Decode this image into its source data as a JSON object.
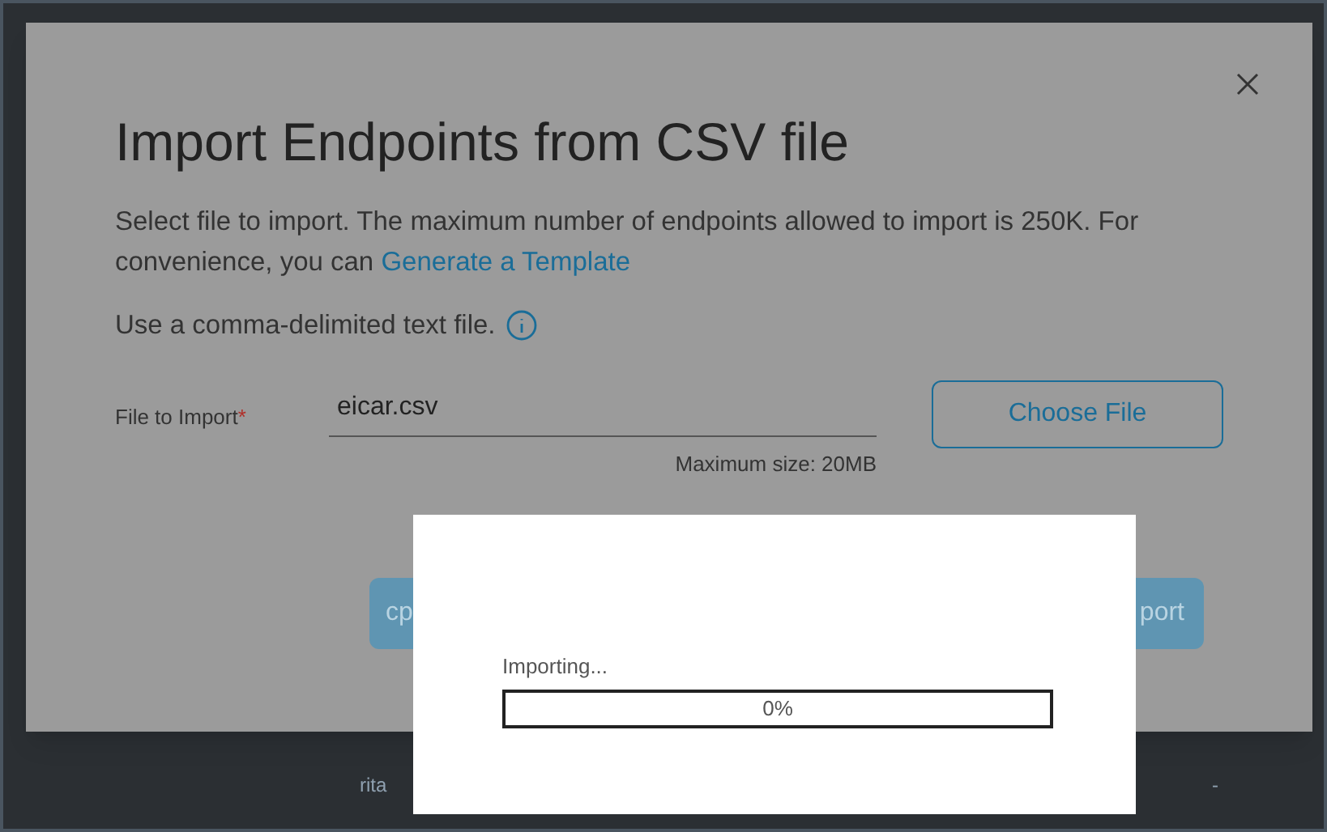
{
  "background": {
    "cells": [
      "rita",
      "-"
    ]
  },
  "dialog": {
    "title": "Import Endpoints from CSV file",
    "intro": "Select file to import. The maximum number of endpoints allowed to import is 250K. For convenience, you can",
    "link": "Generate a Template",
    "hint": "Use a comma-delimited text file.",
    "field": {
      "label": "File to Import",
      "required_mark": "*",
      "value": "eicar.csv",
      "note": "Maximum size: 20MB"
    },
    "choose_button": "Choose File",
    "buttons": [
      "cp",
      "port"
    ]
  },
  "progress": {
    "label": "Importing...",
    "level": 0,
    "reading": "0%"
  }
}
